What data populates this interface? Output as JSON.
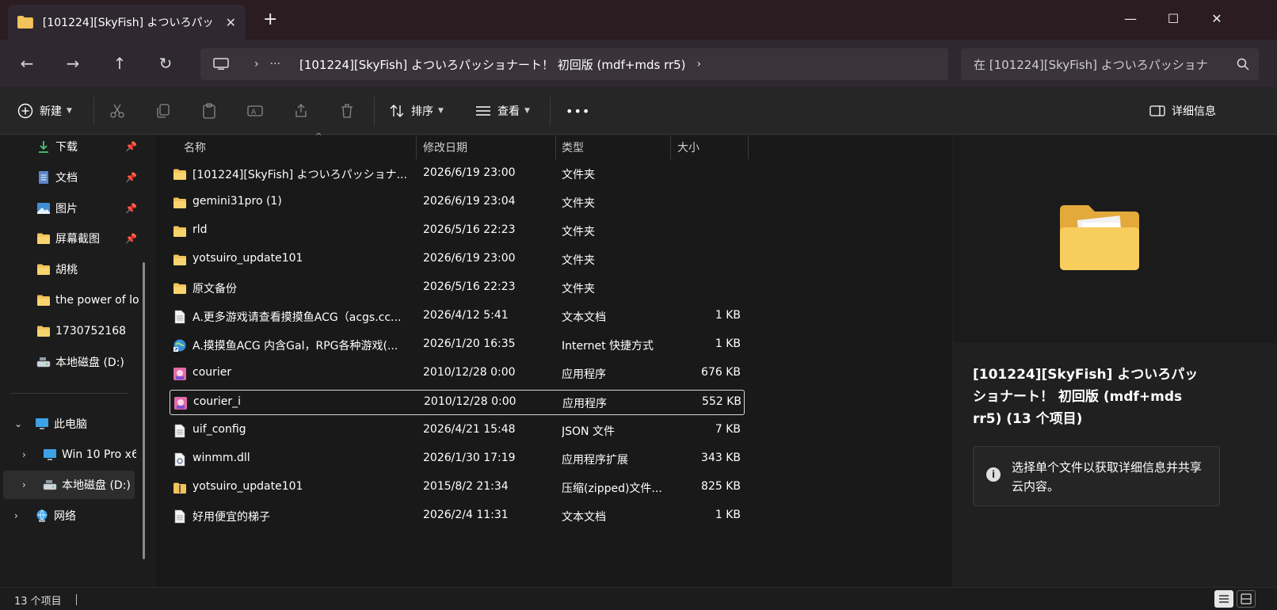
{
  "window": {
    "tab_title": "[101224][SkyFish] よついろパッ",
    "tab_close": "✕",
    "new_tab": "+",
    "minimize": "—",
    "maximize": "☐",
    "close": "✕"
  },
  "nav": {
    "back": "←",
    "forward": "→",
    "up": "↑",
    "refresh": "↻",
    "chevron1": "›",
    "ellipsis": "···",
    "path": "[101224][SkyFish] よついろパッショナート！ 初回版 (mdf+mds rr5)",
    "chevron2": "›",
    "search_placeholder": "在 [101224][SkyFish] よついろパッショナ"
  },
  "commands": {
    "new": "新建",
    "sort": "排序",
    "view": "查看",
    "more": "•••",
    "details": "详细信息"
  },
  "sidebar": {
    "quick": [
      {
        "label": "下载",
        "icon": "download-icon",
        "pinned": true
      },
      {
        "label": "文档",
        "icon": "document-icon",
        "pinned": true
      },
      {
        "label": "图片",
        "icon": "pictures-icon",
        "pinned": true
      },
      {
        "label": "屏幕截图",
        "icon": "folder-icon",
        "pinned": true
      },
      {
        "label": "胡桃",
        "icon": "folder-icon",
        "pinned": false
      },
      {
        "label": "the power of lo",
        "icon": "folder-icon",
        "pinned": false
      },
      {
        "label": "1730752168",
        "icon": "folder-icon",
        "pinned": false
      },
      {
        "label": "本地磁盘 (D:)",
        "icon": "drive-icon",
        "pinned": false
      }
    ],
    "tree": [
      {
        "label": "此电脑",
        "chevron": "⌄"
      },
      {
        "label": "Win 10 Pro x6",
        "chevron": "›"
      },
      {
        "label": "本地磁盘 (D:)",
        "chevron": "›"
      },
      {
        "label": "网络",
        "chevron": "›"
      }
    ],
    "pin_glyph": "📌"
  },
  "columns": {
    "name": "名称",
    "date": "修改日期",
    "type": "类型",
    "size": "大小",
    "sort_glyph": "^"
  },
  "files": [
    {
      "name": "[101224][SkyFish] よついろパッショナ...",
      "date": "2026/6/19 23:00",
      "type": "文件夹",
      "size": "",
      "icon": "folder-icon"
    },
    {
      "name": "gemini31pro (1)",
      "date": "2026/6/19 23:04",
      "type": "文件夹",
      "size": "",
      "icon": "folder-icon"
    },
    {
      "name": "rld",
      "date": "2026/5/16 22:23",
      "type": "文件夹",
      "size": "",
      "icon": "folder-icon"
    },
    {
      "name": "yotsuiro_update101",
      "date": "2026/6/19 23:00",
      "type": "文件夹",
      "size": "",
      "icon": "folder-icon"
    },
    {
      "name": "原文备份",
      "date": "2026/5/16 22:23",
      "type": "文件夹",
      "size": "",
      "icon": "folder-icon"
    },
    {
      "name": "A.更多游戏请查看摸摸鱼ACG（acgs.cc...",
      "date": "2026/4/12 5:41",
      "type": "文本文档",
      "size": "1 KB",
      "icon": "text-file-icon"
    },
    {
      "name": "A.摸摸鱼ACG 内含Gal，RPG各种游戏(...",
      "date": "2026/1/20 16:35",
      "type": "Internet 快捷方式",
      "size": "1 KB",
      "icon": "internet-shortcut-icon"
    },
    {
      "name": "courier",
      "date": "2010/12/28 0:00",
      "type": "应用程序",
      "size": "676 KB",
      "icon": "app-icon"
    },
    {
      "name": "courier_i",
      "date": "2010/12/28 0:00",
      "type": "应用程序",
      "size": "552 KB",
      "icon": "app-icon"
    },
    {
      "name": "uif_config",
      "date": "2026/4/21 15:48",
      "type": "JSON 文件",
      "size": "7 KB",
      "icon": "text-file-icon"
    },
    {
      "name": "winmm.dll",
      "date": "2026/1/30 17:19",
      "type": "应用程序扩展",
      "size": "343 KB",
      "icon": "dll-file-icon"
    },
    {
      "name": "yotsuiro_update101",
      "date": "2015/8/2 21:34",
      "type": "压缩(zipped)文件...",
      "size": "825 KB",
      "icon": "zip-folder-icon"
    },
    {
      "name": "好用便宜的梯子",
      "date": "2026/2/4 11:31",
      "type": "文本文档",
      "size": "1 KB",
      "icon": "text-file-icon"
    }
  ],
  "selected_index": 8,
  "detail": {
    "title": "[101224][SkyFish] よついろパッショナート！ 初回版 (mdf+mds rr5) (13 个项目)",
    "info_glyph": "i",
    "info": "选择单个文件以获取详细信息并共享云内容。"
  },
  "status": {
    "count": "13 个项目"
  },
  "colors": {
    "folder": "#f2c35a",
    "accent": "#4cc2ff",
    "titlebar": "#2b1c22"
  }
}
